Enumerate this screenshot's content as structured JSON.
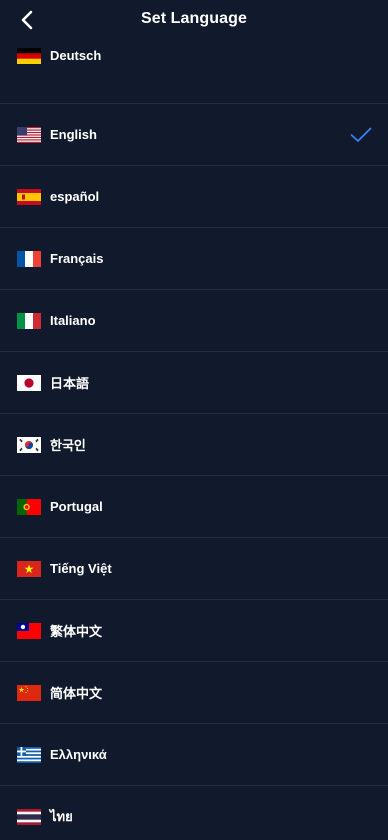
{
  "header": {
    "title": "Set Language",
    "back_icon": "chevron-left-icon"
  },
  "colors": {
    "background": "#111a2c",
    "divider": "#222d44",
    "check": "#3a86ff",
    "text": "#ffffff"
  },
  "languages": [
    {
      "label": "Deutsch",
      "flag": "de",
      "selected": false
    },
    {
      "label": "English",
      "flag": "us",
      "selected": true
    },
    {
      "label": "español",
      "flag": "es",
      "selected": false
    },
    {
      "label": "Français",
      "flag": "fr",
      "selected": false
    },
    {
      "label": "Italiano",
      "flag": "it",
      "selected": false
    },
    {
      "label": "日本語",
      "flag": "jp",
      "selected": false
    },
    {
      "label": "한국인",
      "flag": "kr",
      "selected": false
    },
    {
      "label": "Portugal",
      "flag": "pt",
      "selected": false
    },
    {
      "label": "Tiếng Việt",
      "flag": "vn",
      "selected": false
    },
    {
      "label": "繁体中文",
      "flag": "tw",
      "selected": false
    },
    {
      "label": "简体中文",
      "flag": "cn",
      "selected": false
    },
    {
      "label": "Ελληνικά",
      "flag": "gr",
      "selected": false
    },
    {
      "label": "ไทย",
      "flag": "th",
      "selected": false
    }
  ]
}
